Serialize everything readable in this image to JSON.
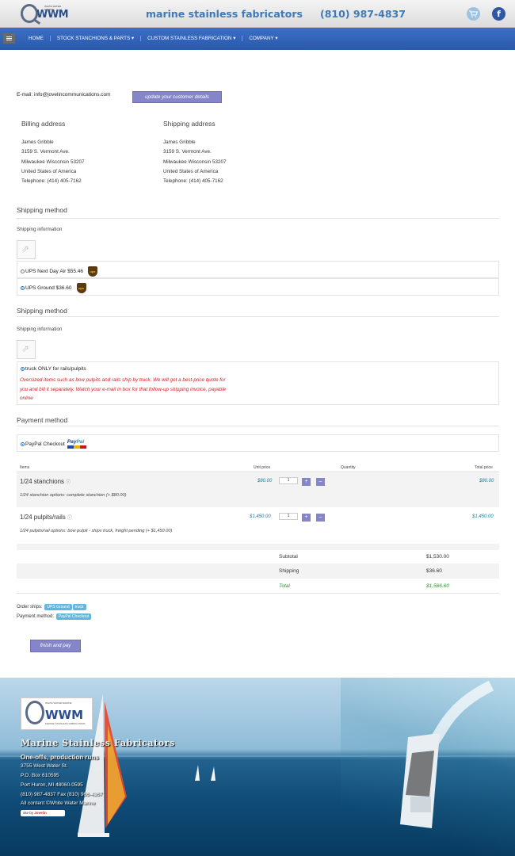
{
  "header": {
    "logo_text": "WWM",
    "logo_tagline": "WHITE WATER MARINE",
    "site_title": "marine stainless fabricators",
    "phone": "(810) 987-4837",
    "cart_icon": "cart-icon",
    "facebook_icon": "facebook-icon",
    "facebook_glyph": "f"
  },
  "nav": {
    "items": [
      {
        "label": "HOME"
      },
      {
        "label": "STOCK STANCHIONS & PARTS ▾"
      },
      {
        "label": "CUSTOM STAINLESS FABRICATION ▾"
      },
      {
        "label": "COMPANY ▾"
      }
    ]
  },
  "account": {
    "email_line": "E-mail: info@jovelincommunications.com",
    "update_button": "update your customer details"
  },
  "billing": {
    "title": "Billing address",
    "lines": [
      "James Gribble",
      "3159 S. Vermont Ave.",
      "Milwaukee Wisconsin 53207",
      "United States of America",
      "Telephone: (414) 405-7162"
    ]
  },
  "shipping_address": {
    "title": "Shipping address",
    "lines": [
      "James Gribble",
      "3159 S. Vermont Ave.",
      "Milwaukee Wisconsin 53207",
      "United States of America",
      "Telephone: (414) 405-7162"
    ]
  },
  "shipping_method_1": {
    "title": "Shipping method",
    "info": "Shipping information",
    "options": [
      {
        "label": "UPS Next Day Air $55.46",
        "selected": false
      },
      {
        "label": "UPS Ground $36.60",
        "selected": true
      }
    ],
    "badge": "ups"
  },
  "shipping_method_2": {
    "title": "Shipping method",
    "info": "Shipping information",
    "option": "truck ONLY for rails/pulpits",
    "note": "Oversized items such as bow pulpits and rails ship by truck. We will get a best-price quote for you and bill it separately. Watch your e-mail in box for that follow-up shipping invoice, payable online"
  },
  "payment": {
    "title": "Payment method",
    "option": "PayPal Checkout",
    "logo_a": "Pay",
    "logo_b": "Pal"
  },
  "cart": {
    "headers": {
      "item": "Items",
      "unit_price": "Unit price",
      "quantity": "Quantity",
      "total": "Total price"
    },
    "items": [
      {
        "name": "1/24 stanchions",
        "info": "ⓘ",
        "desc": "1/24 stanchion options: complete stanchion (+ $80.00)",
        "unit": "$80.00",
        "qty": "1",
        "total": "$80.00"
      },
      {
        "name": "1/24 pulpits/rails",
        "info": "ⓘ",
        "desc": "1/24 pulpits/rail options: bow pulpit - ships truck, freight pending (+ $1,450.00)",
        "unit": "$1,450.00",
        "qty": "1",
        "total": "$1,450.00"
      }
    ],
    "plus": "+",
    "minus": "–",
    "subtotal_label": "Subtotal",
    "subtotal": "$1,530.00",
    "shipping_label": "Shipping",
    "shipping": "$36.60",
    "total_label": "Total",
    "total": "$1,566.60"
  },
  "order": {
    "ships_label": "Order ships:",
    "ships_tags": [
      "UPS Ground",
      "truck"
    ],
    "payment_label": "Payment method:",
    "payment_tag": "PayPal Checkout",
    "finish_button": "finish and pay"
  },
  "footer": {
    "logo_text": "WWM",
    "logo_top": "WHITE WATER MARINE",
    "logo_bottom": "MARINE STAINLESS FABRICATORS",
    "title": "Marine Stainless Fabricators",
    "subtitle": "One-offs, production runs",
    "lines": [
      "3755 West Water St.",
      "P.O. Box 610595",
      "Port Huron, MI 48060-0595",
      "(810) 987-4837 Fax (810) 966-4367",
      "All content ©White Water Marine"
    ],
    "site_by_label": "site by",
    "site_by_name": "Jovelin"
  },
  "colors": {
    "nav": "#2a59ad",
    "accent_button": "#8585c9",
    "tag": "#62b6de",
    "note": "#d42020",
    "total": "#2f8f2f"
  }
}
